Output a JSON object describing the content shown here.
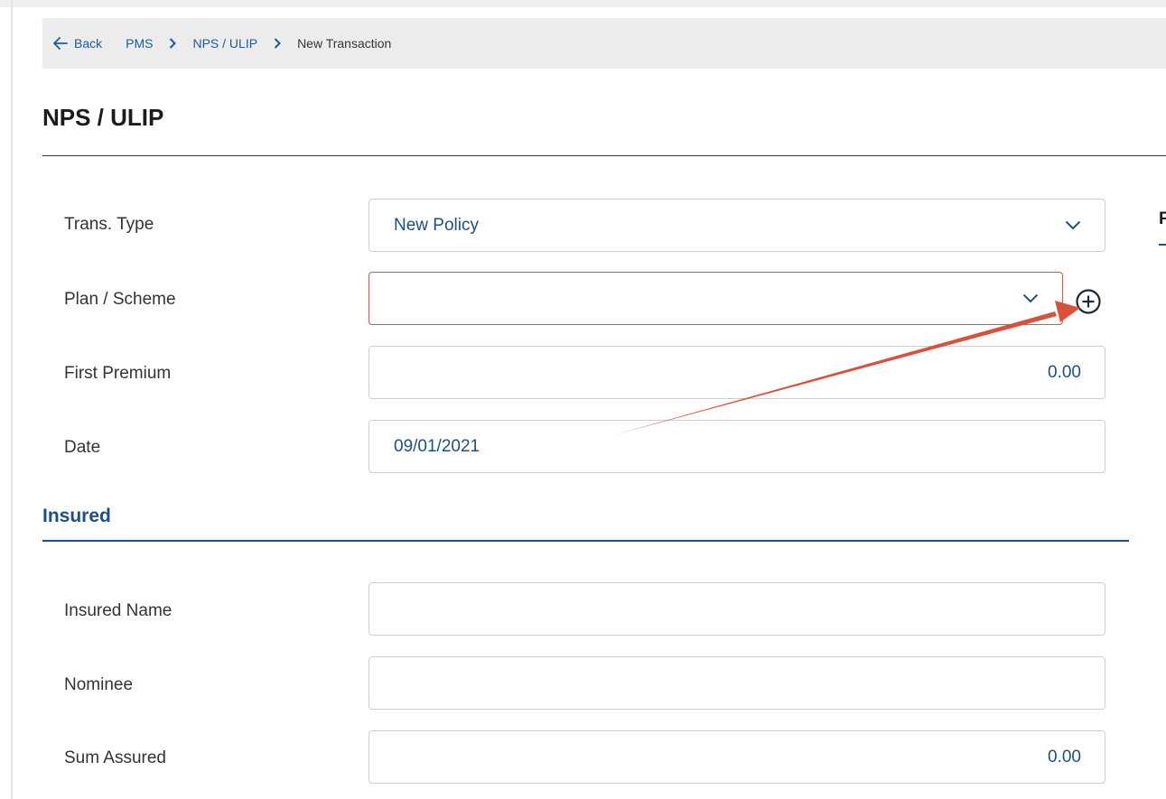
{
  "breadcrumb": {
    "back_label": "Back",
    "items": [
      "PMS",
      "NPS / ULIP",
      "New Transaction"
    ]
  },
  "page": {
    "title": "NPS / ULIP"
  },
  "form": {
    "trans_type": {
      "label": "Trans. Type",
      "value": "New Policy"
    },
    "plan_scheme": {
      "label": "Plan / Scheme",
      "value": ""
    },
    "first_premium": {
      "label": "First Premium",
      "value": "0.00"
    },
    "date": {
      "label": "Date",
      "value": "09/01/2021"
    }
  },
  "insured": {
    "section_title": "Insured",
    "insured_name": {
      "label": "Insured Name",
      "value": ""
    },
    "nominee": {
      "label": "Nominee",
      "value": ""
    },
    "sum_assured": {
      "label": "Sum Assured",
      "value": "0.00"
    }
  },
  "side_tab": {
    "label": "F"
  },
  "icons": {
    "back": "arrow-left-icon",
    "separator": "chevron-right-icon",
    "dropdown": "chevron-down-icon",
    "add": "plus-circle-icon",
    "annotation": "red-arrow"
  },
  "colors": {
    "accent": "#1d4f86",
    "link": "#1d5a9b",
    "error_border": "#e2504a",
    "annotation_arrow": "#d9503b",
    "breadcrumb_bg": "#ececec"
  }
}
